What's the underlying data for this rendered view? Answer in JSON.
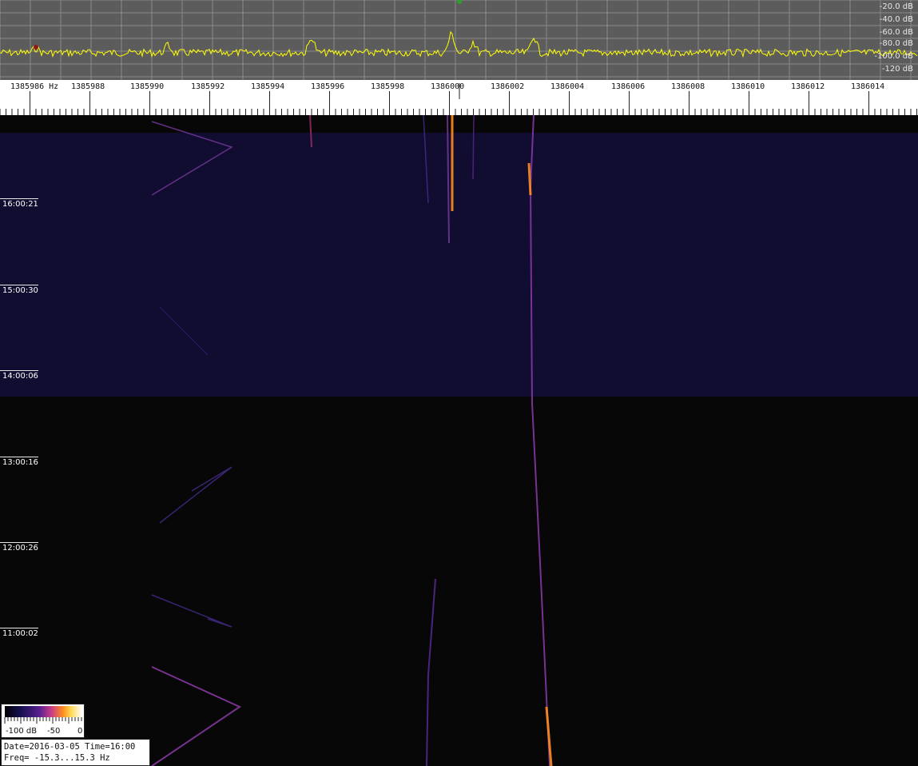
{
  "spectrum": {
    "db_labels": [
      "-20.0 dB",
      "-40.0 dB",
      "-60.0 dB",
      "-80.0 dB",
      "-100.0 dB",
      "-120 dB"
    ],
    "trace_color": "#ffff00",
    "background_color": "#5c5c5c",
    "grid_color": "#8a8a8a"
  },
  "freq_axis": {
    "labels": [
      "1385986 Hz",
      "1385988",
      "1385990",
      "1385992",
      "1385994",
      "1385996",
      "1385998",
      "1386000",
      "1386002",
      "1386004",
      "1386006",
      "1386008",
      "1386010",
      "1386012",
      "1386014"
    ]
  },
  "waterfall": {
    "time_labels": [
      "16:00:21",
      "15:00:30",
      "14:00:06",
      "13:00:16",
      "12:00:26",
      "11:00:02"
    ],
    "noise_color": "#141060",
    "signal_color": "#ff8c20"
  },
  "colorbar": {
    "min_label": "-100 dB",
    "mid_label": "-50",
    "max_label": "0"
  },
  "info": {
    "date_time": "Date=2016-03-05 Time=16:00",
    "freq": "Freq= -15.3...15.3 Hz"
  }
}
